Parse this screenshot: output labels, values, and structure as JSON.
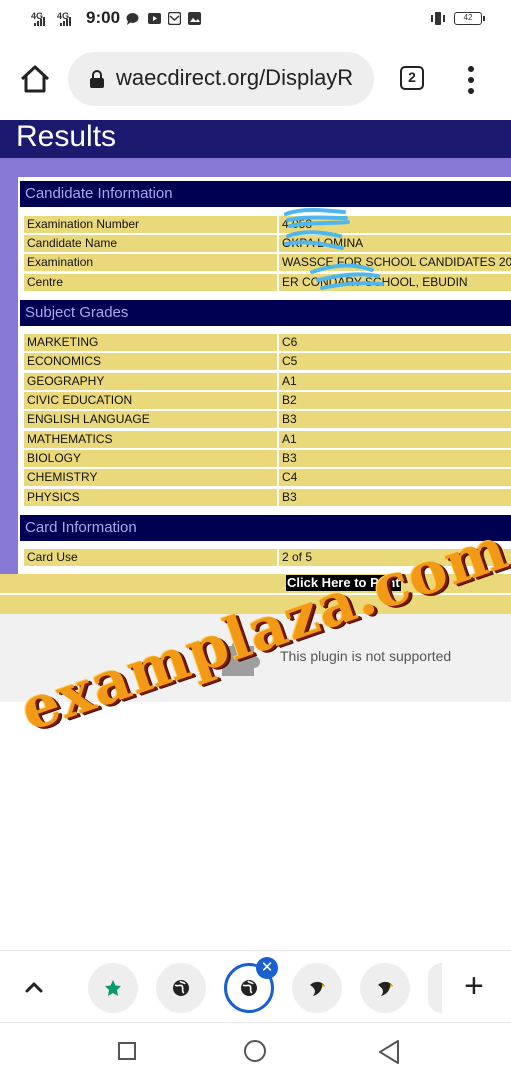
{
  "status_bar": {
    "network_1": "4G",
    "network_2": "4G",
    "time": "9:00",
    "battery": "42"
  },
  "browser": {
    "url": "waecdirect.org/DisplayR",
    "tab_count": "2"
  },
  "page": {
    "title": "Results",
    "candidate_section": {
      "heading": "Candidate Information",
      "rows": [
        {
          "label": "Examination Number",
          "value": "4          058"
        },
        {
          "label": "Candidate Name",
          "value": "OKPA           LOMINA"
        },
        {
          "label": "Examination",
          "value": "WASSCE FOR SCHOOL CANDIDATES 20"
        },
        {
          "label": "Centre",
          "value": "ER           CONDARY SCHOOL, EBUDIN"
        }
      ]
    },
    "grades_section": {
      "heading": "Subject Grades",
      "rows": [
        {
          "subject": "MARKETING",
          "grade": "C6"
        },
        {
          "subject": "ECONOMICS",
          "grade": "C5"
        },
        {
          "subject": "GEOGRAPHY",
          "grade": "A1"
        },
        {
          "subject": "CIVIC EDUCATION",
          "grade": "B2"
        },
        {
          "subject": "ENGLISH LANGUAGE",
          "grade": "B3"
        },
        {
          "subject": "MATHEMATICS",
          "grade": "A1"
        },
        {
          "subject": "BIOLOGY",
          "grade": "B3"
        },
        {
          "subject": "CHEMISTRY",
          "grade": "C4"
        },
        {
          "subject": "PHYSICS",
          "grade": "B3"
        }
      ]
    },
    "card_section": {
      "heading": "Card Information",
      "rows": [
        {
          "label": "Card Use",
          "value": "2 of 5"
        }
      ]
    },
    "print_button": "Click Here to Print",
    "plugin_message": "This plugin is not supported",
    "watermark": "examplaza.com"
  },
  "colors": {
    "header_navy": "#1c1a6e",
    "section_navy": "#000052",
    "row_yellow": "#ead97a",
    "purple_bg": "#8878d6",
    "watermark_orange": "#f29a15",
    "active_tab_blue": "#1a5fd0"
  },
  "bottom_tabs": {
    "icons": [
      "star-favicon",
      "globe-favicon",
      "globe-favicon",
      "bird-favicon",
      "bird-favicon"
    ],
    "active_index": 2
  }
}
